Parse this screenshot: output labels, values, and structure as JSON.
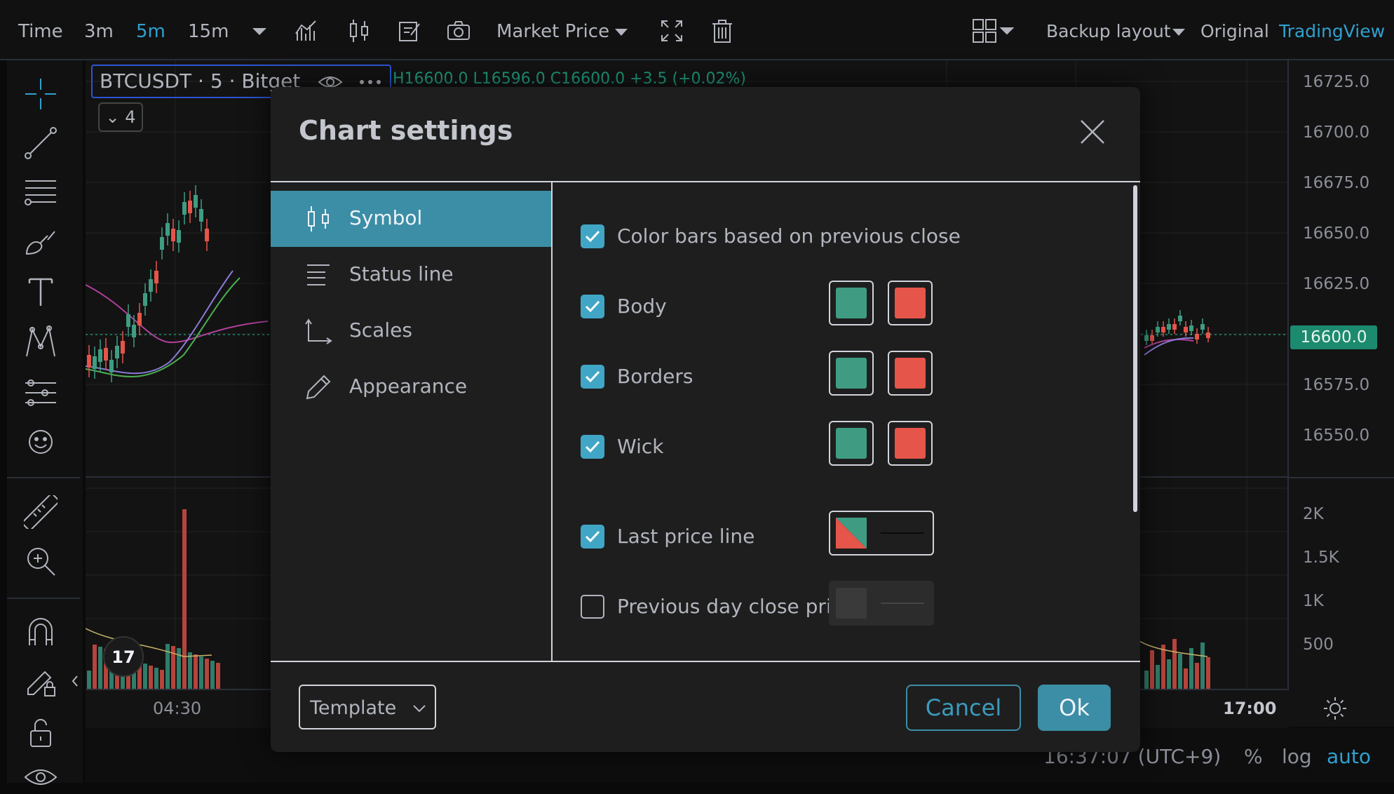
{
  "toolbar": {
    "intervals": [
      "Time",
      "3m",
      "5m",
      "15m"
    ],
    "active_interval": "5m",
    "price_type": "Market Price",
    "backup_layout": "Backup layout",
    "original": "Original",
    "tradingview": "TradingView"
  },
  "symbol": {
    "legend": "BTCUSDT · 5 · Bitget",
    "ohlc": "H16600.0 L16596.0 C16600.0 +3.5 (+0.02%)",
    "collapse_count": "4"
  },
  "price_scale": {
    "labels": [
      "16725.0",
      "16700.0",
      "16675.0",
      "16650.0",
      "16625.0",
      "16575.0",
      "16550.0"
    ],
    "current_price": "16600.0",
    "volume_labels": [
      "2K",
      "1.5K",
      "1K",
      "500"
    ]
  },
  "time_axis": {
    "labels": [
      "04:30",
      "17:00"
    ]
  },
  "status_bar": {
    "clock": "16:37:07 (UTC+9)",
    "percent": "%",
    "log": "log",
    "auto": "auto"
  },
  "dialog": {
    "title": "Chart settings",
    "nav": [
      {
        "label": "Symbol",
        "icon": "candles-icon",
        "active": true
      },
      {
        "label": "Status line",
        "icon": "lines-icon",
        "active": false
      },
      {
        "label": "Scales",
        "icon": "scales-icon",
        "active": false
      },
      {
        "label": "Appearance",
        "icon": "pencil-icon",
        "active": false
      }
    ],
    "settings": [
      {
        "label": "Color bars based on previous close",
        "checked": true
      },
      {
        "label": "Body",
        "checked": true,
        "up_color": "#3f9c82",
        "down_color": "#e5554a"
      },
      {
        "label": "Borders",
        "checked": true,
        "up_color": "#3f9c82",
        "down_color": "#e5554a"
      },
      {
        "label": "Wick",
        "checked": true,
        "up_color": "#3f9c82",
        "down_color": "#e5554a"
      },
      {
        "label": "Last price line",
        "checked": true
      },
      {
        "label": "Previous day close price line",
        "checked": false
      }
    ],
    "template_label": "Template",
    "cancel_label": "Cancel",
    "ok_label": "Ok"
  },
  "colors": {
    "accent": "#3b8ea5",
    "up": "#3f9c82",
    "down": "#e5554a",
    "active_text": "#2fa1cf"
  }
}
